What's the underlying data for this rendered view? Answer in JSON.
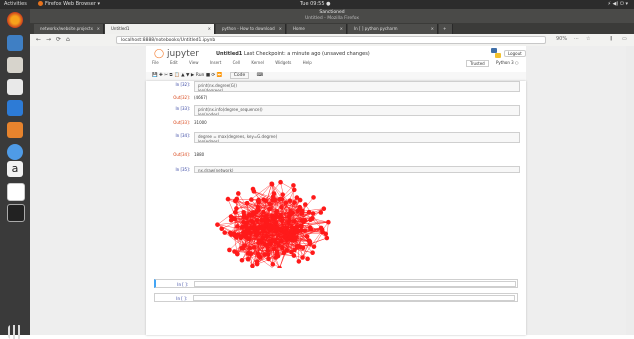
{
  "topbar": {
    "activities": "Activities",
    "app": "Firefox Web Browser ▾",
    "clock": "Tue 09:55 ●",
    "tray": "⚡ ◀) ⏻ ▾"
  },
  "window": {
    "title": "Sanctioned",
    "subtitle": "Untitled - Mozilla Firefox"
  },
  "tabs": [
    {
      "label": "networkx/website.projectx"
    },
    {
      "label": "Untitled1"
    },
    {
      "label": "python - How to download"
    },
    {
      "label": "Home"
    },
    {
      "label": "In [ ] python pycharm"
    }
  ],
  "urlbar": {
    "url": "localhost:8888/notebooks/Untitled1.ipynb",
    "zoom": "90%"
  },
  "jupyter": {
    "logo": "jupyter",
    "notebook_name": "Untitled1",
    "checkpoint": "Last Checkpoint: a minute ago (unsaved changes)",
    "logout": "Logout",
    "trusted": "Trusted",
    "kernel": "Python 3 ○"
  },
  "menu": [
    "File",
    "Edit",
    "View",
    "Insert",
    "Cell",
    "Kernel",
    "Widgets",
    "Help"
  ],
  "toolbar": {
    "cell_type": "Code",
    "icons": "💾 ✚ ✂ ⧉ 📋 ▲ ▼ ▶ Run ■ ⟳ ⏩"
  },
  "cells": [
    {
      "prompt": "In [32]:",
      "code": "print(nx.degree(G))\nlen(degrees)"
    },
    {
      "prompt": "Out[32]:",
      "output": "(4667)"
    },
    {
      "prompt": "In [33]:",
      "code": "print(nx.info(degree_sequence))\nlen(nodes)"
    },
    {
      "prompt": "Out[33]:",
      "output": "31000"
    },
    {
      "prompt": "In [34]:",
      "code": "degree = max(degrees, key=G.degree)\nlen(edges)"
    },
    {
      "prompt": "Out[34]:",
      "output": "1880"
    },
    {
      "prompt": "In [35]:",
      "code": "nx.draw(network)"
    }
  ],
  "empty_cells": [
    {
      "prompt": "In [ ]:"
    },
    {
      "prompt": "In [ ]:"
    }
  ],
  "colors": {
    "node": "#ff1a1a",
    "selected_border": "#42a5f5"
  }
}
